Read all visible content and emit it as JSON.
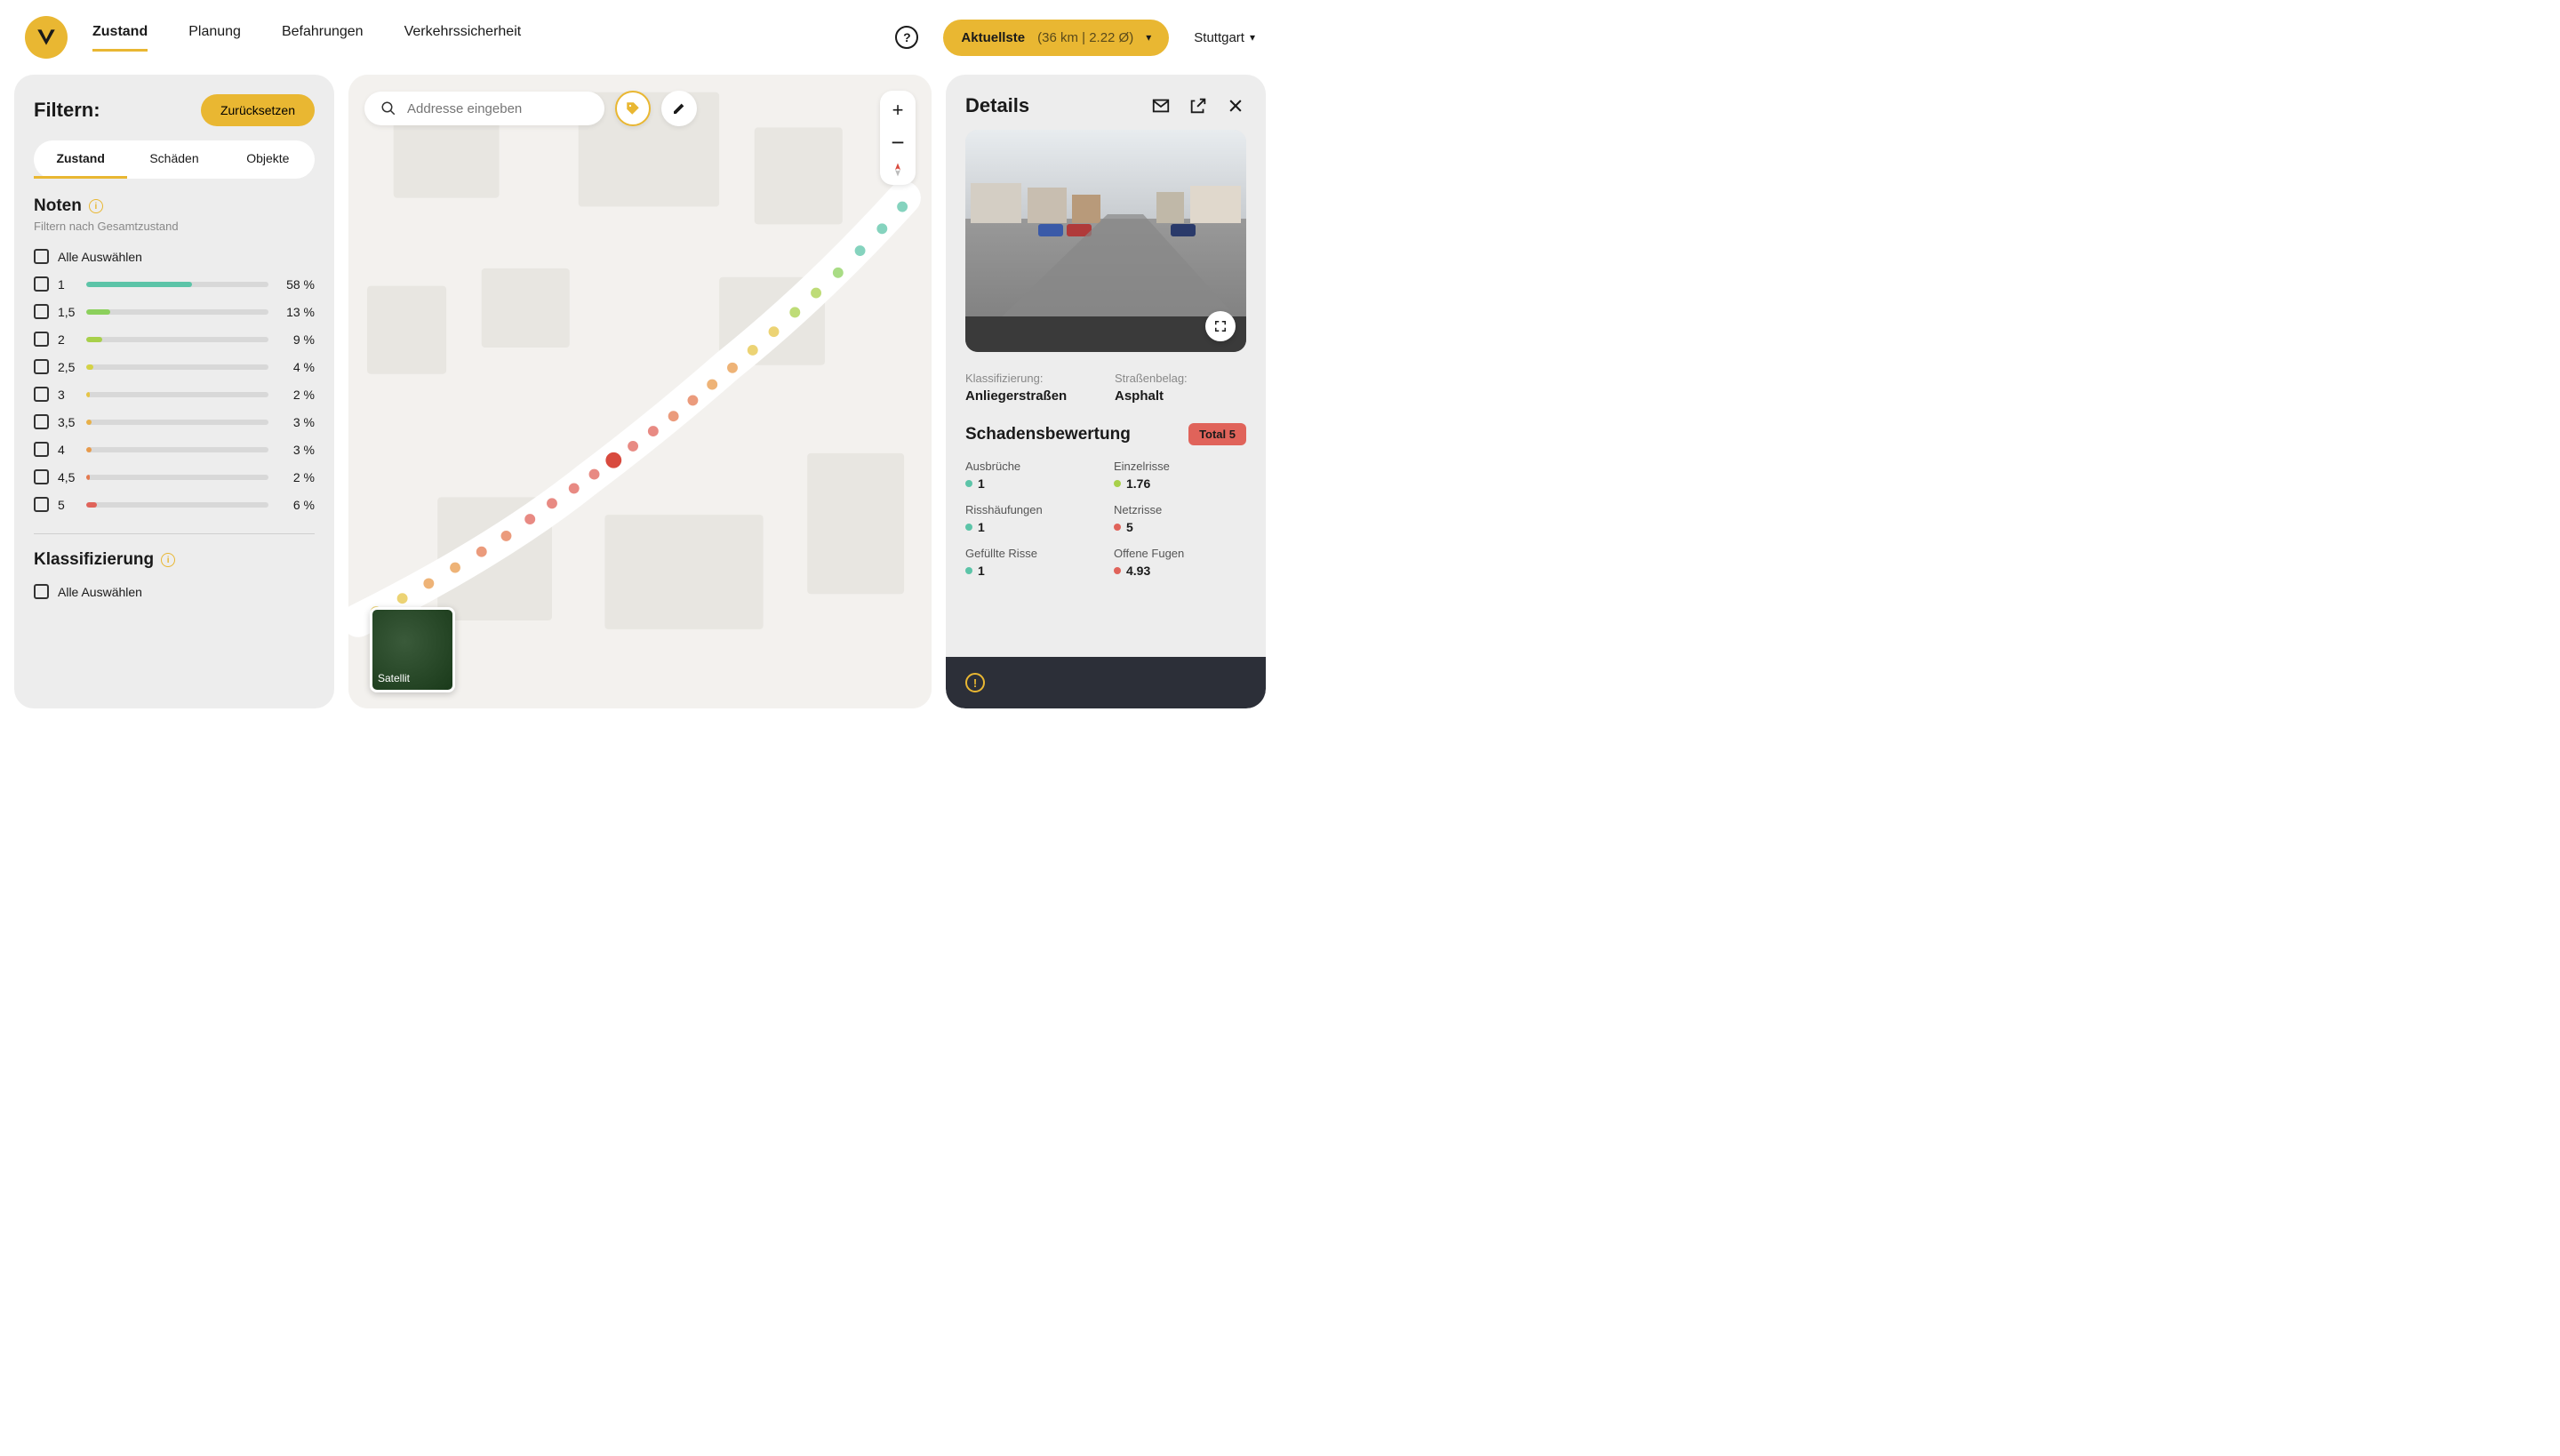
{
  "header": {
    "nav": [
      "Zustand",
      "Planung",
      "Befahrungen",
      "Verkehrssicherheit"
    ],
    "active_nav": 0,
    "help": "?",
    "recent_label": "Aktuellste",
    "recent_detail": "(36 km | 2.22 Ø)",
    "city": "Stuttgart"
  },
  "filter": {
    "title": "Filtern:",
    "reset": "Zurücksetzen",
    "tabs": [
      "Zustand",
      "Schäden",
      "Objekte"
    ],
    "active_tab": 0,
    "grades": {
      "title": "Noten",
      "subtitle": "Filtern nach Gesamtzustand",
      "select_all": "Alle Auswählen",
      "rows": [
        {
          "label": "1",
          "pct": 58,
          "color": "#5cc4a8"
        },
        {
          "label": "1,5",
          "pct": 13,
          "color": "#8cd05c"
        },
        {
          "label": "2",
          "pct": 9,
          "color": "#a8d04a"
        },
        {
          "label": "2,5",
          "pct": 4,
          "color": "#d4d245"
        },
        {
          "label": "3",
          "pct": 2,
          "color": "#e6c445"
        },
        {
          "label": "3,5",
          "pct": 3,
          "color": "#e8b048"
        },
        {
          "label": "4",
          "pct": 3,
          "color": "#e89a4a"
        },
        {
          "label": "4,5",
          "pct": 2,
          "color": "#e47a50"
        },
        {
          "label": "5",
          "pct": 6,
          "color": "#e0635a"
        }
      ]
    },
    "classification": {
      "title": "Klassifizierung",
      "select_all": "Alle Auswählen"
    }
  },
  "map": {
    "search_placeholder": "Addresse eingeben",
    "sat_label": "Satellit"
  },
  "details": {
    "title": "Details",
    "meta": {
      "classification_label": "Klassifizierung:",
      "classification_value": "Anliegerstraßen",
      "surface_label": "Straßenbelag:",
      "surface_value": "Asphalt"
    },
    "damage": {
      "title": "Schadensbewertung",
      "total_label": "Total 5",
      "items": [
        {
          "name": "Ausbrüche",
          "value": "1",
          "color": "#5cc4a8"
        },
        {
          "name": "Einzelrisse",
          "value": "1.76",
          "color": "#a8d04a"
        },
        {
          "name": "Risshäufungen",
          "value": "1",
          "color": "#5cc4a8"
        },
        {
          "name": "Netzrisse",
          "value": "5",
          "color": "#e0635a"
        },
        {
          "name": "Gefüllte Risse",
          "value": "1",
          "color": "#5cc4a8"
        },
        {
          "name": "Offene Fugen",
          "value": "4.93",
          "color": "#e0635a"
        }
      ]
    }
  }
}
